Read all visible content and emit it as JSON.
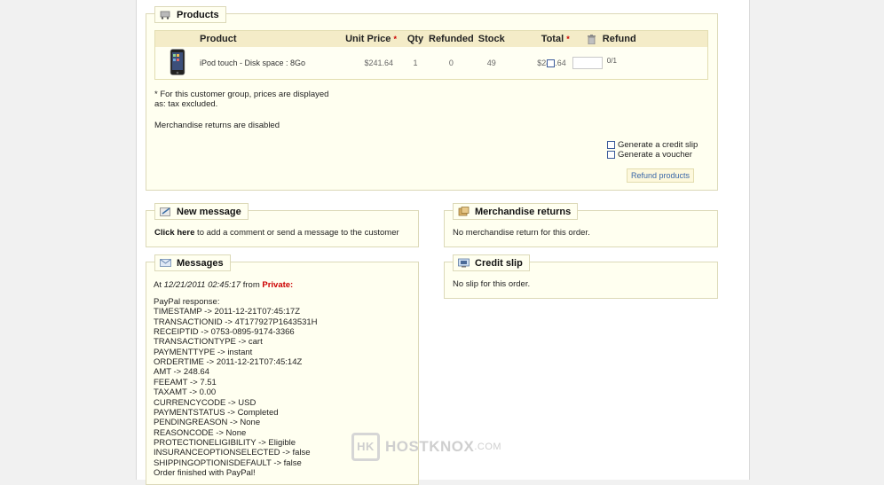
{
  "products": {
    "legend": "Products",
    "columns": [
      "Product",
      "Unit Price",
      "Qty",
      "Refunded",
      "Stock",
      "Total",
      "Refund"
    ],
    "star": "*",
    "row": {
      "name": "iPod touch - Disk space : 8Go",
      "unit_price": "$241.64",
      "qty": "1",
      "refunded": "0",
      "stock": "49",
      "total": "$241.64",
      "refund_qty_suffix": "0/1"
    },
    "note_line1": "* For this customer group, prices are displayed",
    "note_line2": "as: tax excluded.",
    "returns_disabled": "Merchandise returns are disabled",
    "generate_credit_slip": "Generate a credit slip",
    "generate_voucher": "Generate a voucher",
    "refund_button": "Refund products"
  },
  "new_message": {
    "legend": "New message",
    "click_here": "Click here",
    "text": " to add a comment or send a message to the customer"
  },
  "merchandise_returns": {
    "legend": "Merchandise returns",
    "text": "No merchandise return for this order."
  },
  "credit_slip": {
    "legend": "Credit slip",
    "text": "No slip for this order."
  },
  "messages": {
    "legend": "Messages",
    "header_prefix": "At ",
    "header_date": "12/21/2011 02:45:17",
    "header_from": " from ",
    "header_private": "Private:",
    "lines": [
      "PayPal response:",
      "TIMESTAMP -> 2011-12-21T07:45:17Z",
      "TRANSACTIONID -> 4T177927P1643531H",
      "RECEIPTID -> 0753-0895-9174-3366",
      "TRANSACTIONTYPE -> cart",
      "PAYMENTTYPE -> instant",
      "ORDERTIME -> 2011-12-21T07:45:14Z",
      "AMT -> 248.64",
      "FEEAMT -> 7.51",
      "TAXAMT -> 0.00",
      "CURRENCYCODE -> USD",
      "PAYMENTSTATUS -> Completed",
      "PENDINGREASON -> None",
      "REASONCODE -> None",
      "PROTECTIONELIGIBILITY -> Eligible",
      "INSURANCEOPTIONSELECTED -> false",
      "SHIPPINGOPTIONISDEFAULT -> false",
      "Order finished with PayPal!"
    ]
  },
  "watermark": {
    "badge": "HK",
    "brand": "HOSTKNOX",
    "tld": ".COM"
  }
}
